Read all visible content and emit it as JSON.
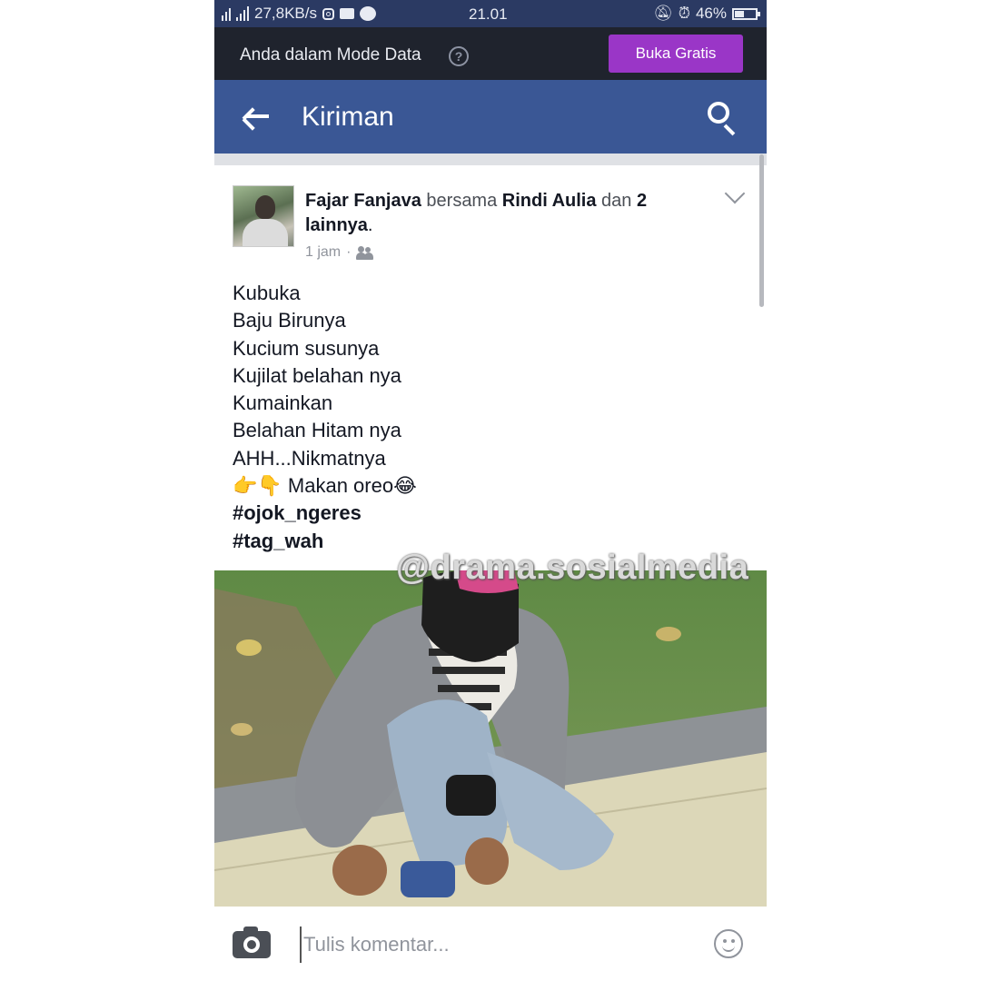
{
  "status_bar": {
    "network_speed": "27,8KB/s",
    "time": "21.01",
    "battery": "46%",
    "battery_level": 0.46
  },
  "data_mode": {
    "message": "Anda dalam Mode Data",
    "help": "?",
    "button_label": "Buka Gratis"
  },
  "header": {
    "title": "Kiriman"
  },
  "post": {
    "author": "Fajar Fanjava",
    "with_word": "bersama",
    "tagged": "Rindi Aulia",
    "and_word": "dan",
    "others_bold": "2",
    "others_rest": "lainnya",
    "period": ".",
    "time": "1 jam",
    "separator": "·",
    "lines": [
      "Kubuka",
      "Baju Birunya",
      "Kucium susunya",
      "Kujilat belahan nya",
      "Kumainkan",
      "Belahan Hitam nya",
      "AHH...Nikmatnya"
    ],
    "emoji_line": {
      "prefix": "👉👇",
      "text": " Makan oreo",
      "suffix": "😂"
    },
    "hashtags": [
      "#ojok_ngeres",
      "#tag_wah"
    ],
    "watermark": "@drama.sosialmedia"
  },
  "comment": {
    "placeholder": "Tulis komentar..."
  },
  "colors": {
    "header_blue": "#3a5795",
    "status_bar": "#2b3a63",
    "data_bar": "#1f232d",
    "button_purple": "#9a36c7"
  },
  "icons": [
    "signal-icon",
    "instagram-icon",
    "message-icon",
    "chat-icon",
    "mute-icon",
    "alarm-icon",
    "battery-icon",
    "help-icon",
    "back-arrow-icon",
    "search-icon",
    "chevron-down-icon",
    "friends-icon",
    "camera-icon",
    "smiley-icon"
  ]
}
